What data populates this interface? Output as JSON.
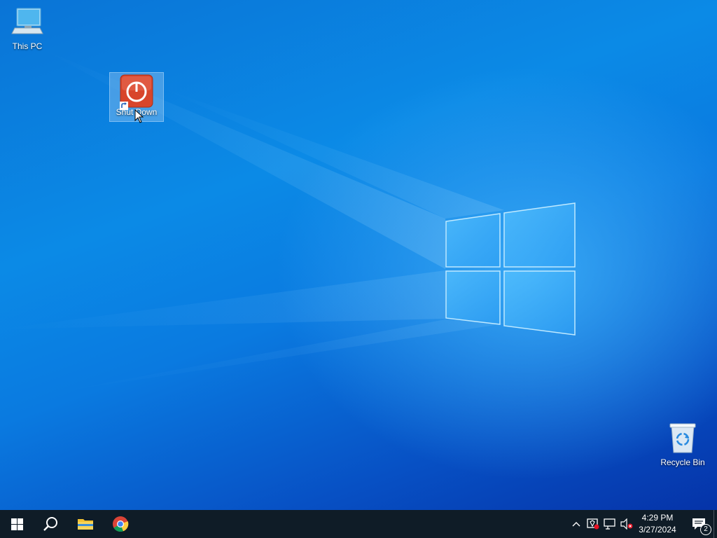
{
  "desktop": {
    "icons": [
      {
        "label": "This PC",
        "icon": "computer-icon"
      },
      {
        "label": "Shut Down",
        "icon": "power-icon",
        "shortcut": true,
        "selected": true
      },
      {
        "label": "Recycle Bin",
        "icon": "recycle-bin-icon"
      }
    ]
  },
  "taskbar": {
    "buttons": [
      {
        "name": "start",
        "icon": "windows-logo-icon"
      },
      {
        "name": "search",
        "icon": "search-icon"
      },
      {
        "name": "file-explorer",
        "icon": "folder-icon"
      },
      {
        "name": "chrome",
        "icon": "chrome-icon"
      }
    ],
    "tray": {
      "icons": [
        "chevron-up-icon",
        "security-icon",
        "network-icon",
        "volume-muted-icon"
      ],
      "time": "4:29 PM",
      "date": "3/27/2024",
      "notification_count": "2"
    }
  },
  "colors": {
    "taskbar": "#0f1c27",
    "wallpaper_blue": "#0b8ae6",
    "power_red": "#d8452b"
  }
}
